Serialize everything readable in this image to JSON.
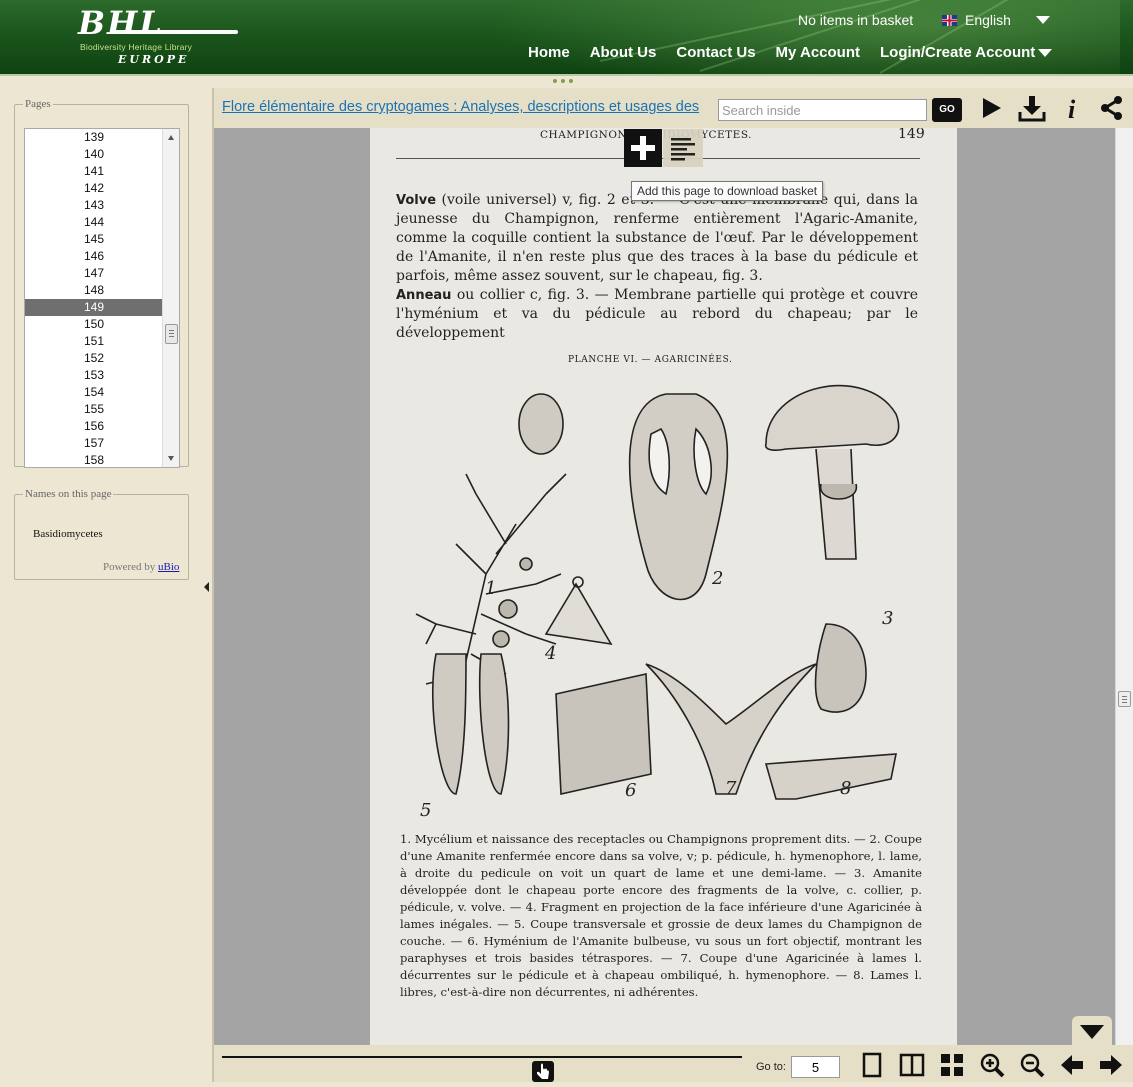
{
  "header": {
    "logo": {
      "text": "BHL",
      "subtitle": "Biodiversity Heritage Library",
      "region": "EUROPE"
    },
    "basket_status": "No items in basket",
    "language": "English",
    "nav": [
      "Home",
      "About Us",
      "Contact Us",
      "My Account",
      "Login/Create Account"
    ]
  },
  "left_panel": {
    "pages_legend": "Pages",
    "pages": [
      "139",
      "140",
      "141",
      "142",
      "143",
      "144",
      "145",
      "146",
      "147",
      "148",
      "149",
      "150",
      "151",
      "152",
      "153",
      "154",
      "155",
      "156",
      "157",
      "158"
    ],
    "selected_page": "149",
    "names_legend": "Names on this page",
    "names": [
      "Basidiomycetes"
    ],
    "powered_by_prefix": "Powered by",
    "powered_by_link": "uBio"
  },
  "toolbar": {
    "book_title": "Flore élémentaire des cryptogames : Analyses, descriptions et usages des",
    "search_placeholder": "Search inside",
    "go_label": "GO",
    "icons": [
      "play-icon",
      "download-icon",
      "info-icon",
      "share-icon"
    ]
  },
  "overlay": {
    "tooltip": "Add this page to download basket"
  },
  "page_content": {
    "running_head": "CHAMPIGNONS BASIDIOMYCETES.",
    "page_number": "149",
    "paragraph1_term": "Volve",
    "paragraph1": " (voile universel) v, fig. 2 et 3. — C'est une membrane qui, dans la jeunesse du Champignon, renferme entièrement l'Agaric-Amanite, comme la coquille contient la substance de l'œuf. Par le développement de l'Amanite, il n'en reste plus que des traces à la base du pédicule et parfois, même assez souvent, sur le chapeau, fig. 3.",
    "paragraph2_term": "Anneau",
    "paragraph2": " ou collier c, fig. 3. — Membrane partielle qui protège et couvre l'hyménium et va du pédicule au rebord du chapeau; par le développement",
    "plate_title": "PLANCHE VI. — AGARICINÉES.",
    "caption": "1. Mycélium et naissance des receptacles ou Champignons proprement dits. — 2. Coupe d'une Amanite renfermée encore dans sa volve, v; p. pédicule, h. hymenophore, l. lame, à droite du pedicule on voit un quart de lame et une demi-lame. — 3. Amanite développée dont le chapeau porte encore des fragments de la volve, c. collier, p. pédicule, v. volve. — 4. Fragment en projection de la face inférieure d'une Agaricinée à lames inégales. — 5. Coupe transversale et grossie de deux lames du Champignon de couche. — 6. Hyménium de l'Amanite bulbeuse, vu sous un fort objectif, montrant les paraphyses et trois basides tétraspores. — 7. Coupe d'une Agaricinée à lames l. décurrentes sur le pédicule et à chapeau ombiliqué, h. hymenophore. — 8. Lames l. libres, c'est-à-dire non décurrentes, ni adhérentes.",
    "figure_numbers": [
      "1",
      "2",
      "3",
      "4",
      "5",
      "6",
      "7",
      "8"
    ]
  },
  "bottom_bar": {
    "goto_label": "Go to:",
    "goto_value": "5",
    "icons": [
      "single-page-icon",
      "two-page-icon",
      "thumbnails-icon",
      "zoom-in-icon",
      "zoom-out-icon",
      "prev-arrow-icon",
      "next-arrow-icon"
    ]
  },
  "colors": {
    "header_green": "#1c561d",
    "panel_beige": "#ece6d2",
    "toolbar_beige": "#e6dfc7",
    "viewer_gray": "#a4a4a4",
    "selected_row": "#6f6f6f",
    "link_blue": "#1a73b5"
  }
}
